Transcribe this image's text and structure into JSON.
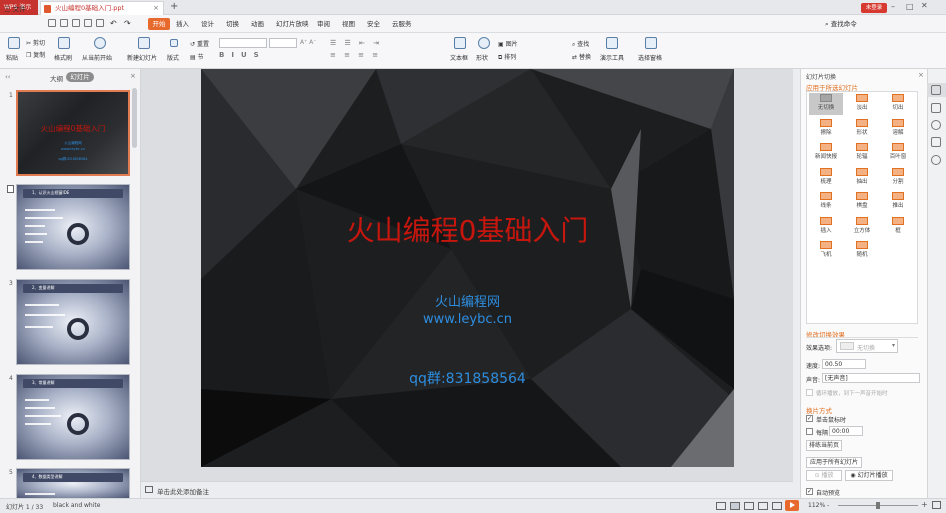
{
  "titlebar": {
    "app_tab": "WPS 演示",
    "doc_tab": "火山编程0基础入门.ppt",
    "login": "未登录"
  },
  "menubar": {
    "file": "三 文件",
    "tabs": [
      "开始",
      "插入",
      "设计",
      "切换",
      "动画",
      "幻灯片放映",
      "审阅",
      "视图",
      "安全",
      "云服务"
    ],
    "search": "查找命令"
  },
  "ribbon": {
    "paste": "粘贴",
    "cut": "剪切",
    "copy": "复制",
    "format_painter": "格式刷",
    "from_start": "从当前开始",
    "new_slide": "新建幻灯片",
    "layout": "版式",
    "reset": "重置",
    "section": "节",
    "textbox": "文本框",
    "shape": "形状",
    "picture": "图片",
    "arrange": "排列",
    "find": "查找",
    "replace": "替换",
    "tools": "演示工具",
    "select_pane": "选择窗格"
  },
  "leftpane": {
    "tab_outline": "大纲",
    "tab_slides": "幻灯片",
    "slides": [
      {
        "num": "1",
        "title": "火山编程0基础入门"
      },
      {
        "num": "2",
        "title": "1、认识火山视窗IDE"
      },
      {
        "num": "3",
        "title": "2、变量讲解"
      },
      {
        "num": "4",
        "title": "3、常量讲解"
      },
      {
        "num": "5",
        "title": "4、数据类型讲解"
      }
    ]
  },
  "slide": {
    "title": "火山编程0基础入门",
    "subtitle": "火山编程网",
    "url": "www.leybc.cn",
    "qq": "qq群:831858564"
  },
  "notes": {
    "placeholder": "单击此处添加备注"
  },
  "rightpane": {
    "title": "幻灯片切换",
    "apply_selected": "应用于所选幻灯片",
    "transitions": [
      "无切换",
      "淡出",
      "切出",
      "擦除",
      "形状",
      "溶解",
      "新闻快报",
      "轮辐",
      "百叶窗",
      "梳理",
      "抽出",
      "分割",
      "线条",
      "棋盘",
      "推出",
      "插入",
      "立方体",
      "框",
      "飞机",
      "随机"
    ],
    "modify_effect": "修改切换效果",
    "effect_option_label": "效果选项:",
    "effect_option_value": "无切换",
    "speed_label": "速度:",
    "speed_value": "00.50",
    "sound_label": "声音:",
    "sound_value": "[无声音]",
    "loop_sound": "循环播放，到下一声音开始时",
    "advance_title": "换片方式",
    "on_click": "单击鼠标时",
    "every": "每隔",
    "every_value": "00:00",
    "sort_current": "排练当前页",
    "apply_all": "应用于所有幻灯片",
    "play": "播放",
    "slideshow": "幻灯片播放",
    "auto_preview": "自动预览"
  },
  "statusbar": {
    "slide_pos": "幻灯片 1 / 33",
    "theme": "black and white",
    "zoom": "112% -"
  }
}
